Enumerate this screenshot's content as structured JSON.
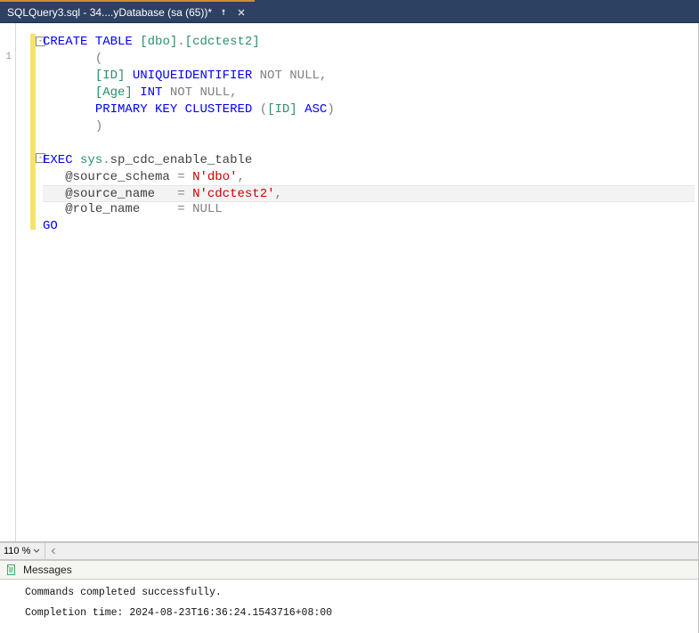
{
  "tab": {
    "title": "SQLQuery3.sql - 34....yDatabase (sa (65))*",
    "pin_icon": "pin-icon",
    "close_icon": "close-icon"
  },
  "line_marker": "1",
  "code": {
    "lines": [
      [
        {
          "cls": "kw",
          "t": "CREATE"
        },
        {
          "t": " "
        },
        {
          "cls": "kw",
          "t": "TABLE"
        },
        {
          "t": " "
        },
        {
          "cls": "brkt",
          "t": "[dbo]"
        },
        {
          "cls": "gray",
          "t": "."
        },
        {
          "cls": "brkt",
          "t": "[cdctest2]"
        }
      ],
      [
        {
          "t": "       "
        },
        {
          "cls": "gray",
          "t": "("
        }
      ],
      [
        {
          "t": "       "
        },
        {
          "cls": "brkt",
          "t": "[ID]"
        },
        {
          "t": " "
        },
        {
          "cls": "type",
          "t": "UNIQUEIDENTIFIER"
        },
        {
          "t": " "
        },
        {
          "cls": "gray",
          "t": "NOT"
        },
        {
          "t": " "
        },
        {
          "cls": "gray",
          "t": "NULL"
        },
        {
          "cls": "gray",
          "t": ","
        }
      ],
      [
        {
          "t": "       "
        },
        {
          "cls": "brkt",
          "t": "[Age]"
        },
        {
          "t": " "
        },
        {
          "cls": "type",
          "t": "INT"
        },
        {
          "t": " "
        },
        {
          "cls": "gray",
          "t": "NOT"
        },
        {
          "t": " "
        },
        {
          "cls": "gray",
          "t": "NULL"
        },
        {
          "cls": "gray",
          "t": ","
        }
      ],
      [
        {
          "t": "       "
        },
        {
          "cls": "kw",
          "t": "PRIMARY"
        },
        {
          "t": " "
        },
        {
          "cls": "kw",
          "t": "KEY"
        },
        {
          "t": " "
        },
        {
          "cls": "kw",
          "t": "CLUSTERED"
        },
        {
          "t": " "
        },
        {
          "cls": "gray",
          "t": "("
        },
        {
          "cls": "brkt",
          "t": "[ID]"
        },
        {
          "t": " "
        },
        {
          "cls": "kw",
          "t": "ASC"
        },
        {
          "cls": "gray",
          "t": ")"
        }
      ],
      [
        {
          "t": "       "
        },
        {
          "cls": "gray",
          "t": ")"
        }
      ],
      [],
      [
        {
          "cls": "kw",
          "t": "EXEC"
        },
        {
          "t": " "
        },
        {
          "cls": "sys",
          "t": "sys"
        },
        {
          "cls": "gray",
          "t": "."
        },
        {
          "cls": "var",
          "t": "sp_cdc_enable_table"
        }
      ],
      [
        {
          "t": "   "
        },
        {
          "cls": "var",
          "t": "@source_schema"
        },
        {
          "t": " "
        },
        {
          "cls": "gray",
          "t": "="
        },
        {
          "t": " "
        },
        {
          "cls": "red",
          "t": "N'dbo'"
        },
        {
          "cls": "gray",
          "t": ","
        }
      ],
      [
        {
          "t": "   "
        },
        {
          "cls": "var",
          "t": "@source_name"
        },
        {
          "t": "   "
        },
        {
          "cls": "gray",
          "t": "="
        },
        {
          "t": " "
        },
        {
          "cls": "red",
          "t": "N'cdctest2'"
        },
        {
          "cls": "gray",
          "t": ","
        }
      ],
      [
        {
          "t": "   "
        },
        {
          "cls": "var",
          "t": "@role_name"
        },
        {
          "t": "     "
        },
        {
          "cls": "gray",
          "t": "="
        },
        {
          "t": " "
        },
        {
          "cls": "gray",
          "t": "NULL"
        }
      ],
      [
        {
          "cls": "kw",
          "t": "GO"
        }
      ]
    ],
    "highlight_index": 9,
    "fold_positions": [
      0,
      7
    ]
  },
  "zoom": {
    "value": "110 %"
  },
  "messages": {
    "tab_label": "Messages",
    "lines": [
      "Commands completed successfully.",
      "Completion time: 2024-08-23T16:36:24.1543716+08:00"
    ]
  }
}
